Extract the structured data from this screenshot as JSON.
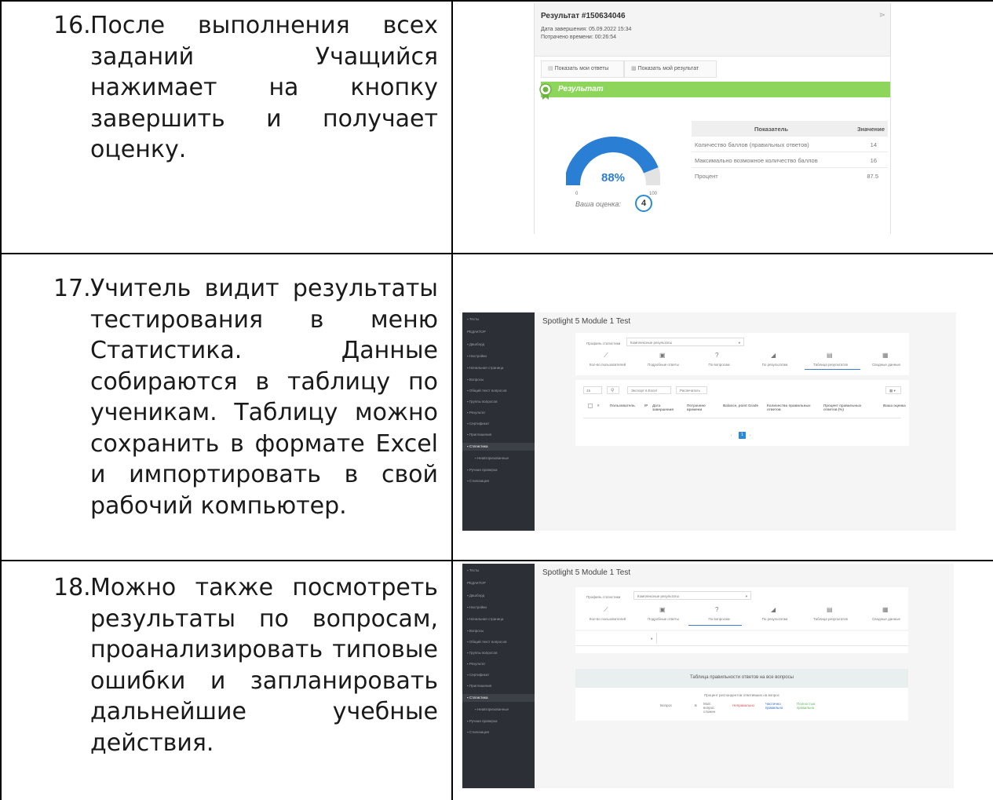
{
  "steps": [
    {
      "num": "16.",
      "text": "После выполнения всех заданий Учащийся нажимает на кнопку завершить и получает оценку."
    },
    {
      "num": "17.",
      "text": "Учитель видит результаты тестирования в меню Статистика. Данные собираются в таблицу по ученикам. Таблицу можно сохранить в формате Excel и импортировать в свой рабочий компьютер."
    },
    {
      "num": "18.",
      "text": "Можно также посмотреть результаты по вопросам, проанализировать типовые ошибки и запланировать дальнейшие учебные действия."
    }
  ],
  "result_screen": {
    "title": "Результат #150634046",
    "finish_date": "Дата завершения:  05.09.2022 15:34",
    "time_spent": "Потрачено времени:  00:26:54",
    "tab_answers": "Показать мои ответы",
    "tab_result": "Показать мой результат",
    "banner": "Результат",
    "percent": "88%",
    "gauge_min": "0",
    "gauge_max": "100",
    "gauge_fraction": 0.88,
    "grade_label": "Ваша оценка:",
    "grade": "4",
    "table_header": {
      "metric": "Показатель",
      "value": "Значение"
    },
    "rows": [
      {
        "metric": "Количество баллов (правильных ответов)",
        "value": "14"
      },
      {
        "metric": "Максимально возможное количество баллов",
        "value": "16"
      },
      {
        "metric": "Процент",
        "value": "87.5"
      }
    ]
  },
  "stats_screen": {
    "title": "Spotlight 5 Module 1 Test",
    "sidebar": [
      "Тесты",
      "РЕДАКТОР",
      "Дашборд",
      "Настройки",
      "Начальная страница",
      "Вопросы",
      "Общий текст вопросов",
      "Группы вопросов",
      "Результат",
      "Сертификат",
      "Приглашения",
      "Статистика",
      "Неавторизованные",
      "Ручная проверка",
      "Стилизация"
    ],
    "filter_label": "Профиль статистики",
    "filter_value": "Комплексные результаты",
    "tabs": [
      "Кол-во пользователей",
      "Подробные ответы",
      "По вопросам",
      "По результатам",
      "Таблица результатов",
      "Сводные данные"
    ],
    "per_page": "15",
    "export_excel": "Экспорт в Excel",
    "print": "Распечатать",
    "columns": [
      "#",
      "Пользователь",
      "IP",
      "Дата завершения",
      "Потрачено времени",
      "Balance, point",
      "Grade",
      "Количество правильных ответов",
      "Процент правильных ответов (%)",
      "Ваша оценка"
    ],
    "page": "1"
  },
  "questions_screen": {
    "title": "Spotlight 5 Module 1 Test",
    "filter_value": "Комплексные результаты",
    "table_title": "Таблица правильности ответов на все вопросы",
    "subtitle": "Процент респондентов ответивших на вопрос",
    "col_question": "Вопрос",
    "col_num": "Б",
    "legend": [
      "Мой вопрос сложен",
      "Неправильно",
      "Частично правильно",
      "Полностью правильно"
    ]
  }
}
